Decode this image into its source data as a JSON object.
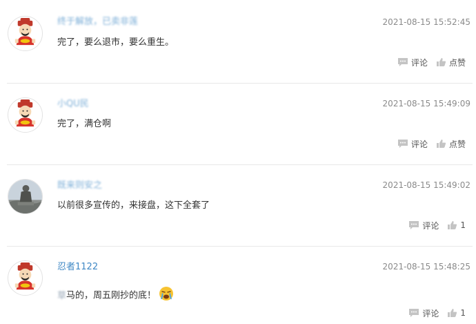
{
  "comments": [
    {
      "username": "终于解放，已卖非莲",
      "time": "2021-08-15 15:52:45",
      "content": "完了，要么退市，要么重生。",
      "comment_label": "评论",
      "like_label": "点赞",
      "avatar_icon": "caishen-avatar-icon"
    },
    {
      "username": "小QU民",
      "time": "2021-08-15 15:49:09",
      "content": "完了，满仓啊",
      "comment_label": "评论",
      "like_label": "点赞",
      "avatar_icon": "caishen-avatar-icon"
    },
    {
      "username": "既来则安之",
      "time": "2021-08-15 15:49:02",
      "content": "以前很多宣传的，来接盘，这下全套了",
      "comment_label": "评论",
      "like_label": "1",
      "avatar_icon": "statue-photo-avatar"
    },
    {
      "username": "忍者1122",
      "time": "2021-08-15 15:48:25",
      "content_masked": "草",
      "content": "马的，周五刚抄的底！",
      "comment_label": "评论",
      "like_label": "1",
      "avatar_icon": "caishen-avatar-icon",
      "emoji_icon": "crying-emoji-icon"
    }
  ],
  "colors": {
    "username": "#3f88c5",
    "time": "#8a8a8a",
    "content": "#333333",
    "action_icon": "#c4c4c4",
    "divider": "#e8e8e8"
  }
}
